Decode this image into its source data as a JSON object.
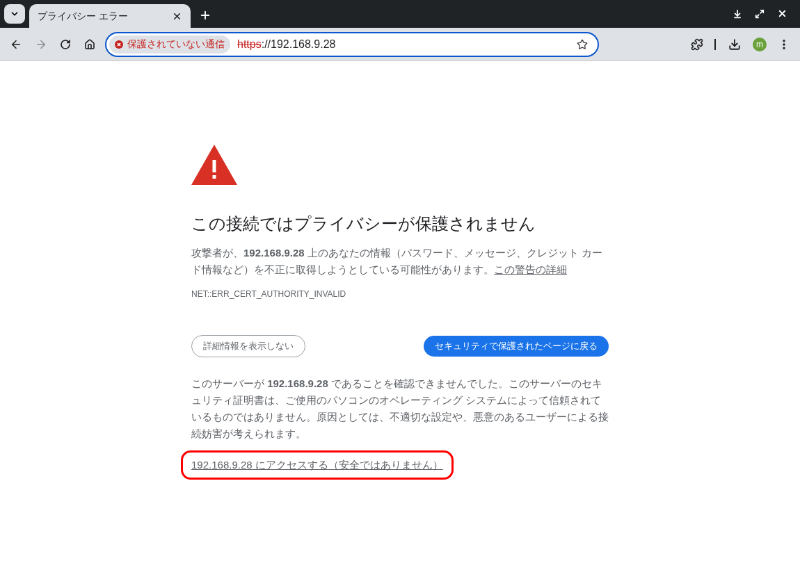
{
  "tab": {
    "title": "プライバシー エラー",
    "selected": true
  },
  "address_bar": {
    "security_label": "保護されていない通信",
    "scheme": "https",
    "rest": "://192.168.9.28"
  },
  "profile": {
    "initial": "m"
  },
  "page": {
    "title": "この接続ではプライバシーが保護されません",
    "warning": "攻撃者が、**192.168.9.28** 上のあなたの情報（パスワード、メッセージ、クレジット カード情報など）を不正に取得しようとしている可能性があります。",
    "details_link": "この警告の詳細",
    "error_code": "NET::ERR_CERT_AUTHORITY_INVALID",
    "hide_details_button": "詳細情報を表示しない",
    "back_button": "セキュリティで保護されたページに戻る",
    "explanation": "このサーバーが **192.168.9.28** であることを確認できませんでした。このサーバーのセキュリティ証明書は、ご使用のパソコンのオペレーティング システムによって信頼されているものではありません。原因としては、不適切な設定や、悪意のあるユーザーによる接続妨害が考えられます。",
    "proceed_link": "192.168.9.28 にアクセスする（安全ではありません）",
    "proceed_highlighted": true
  }
}
